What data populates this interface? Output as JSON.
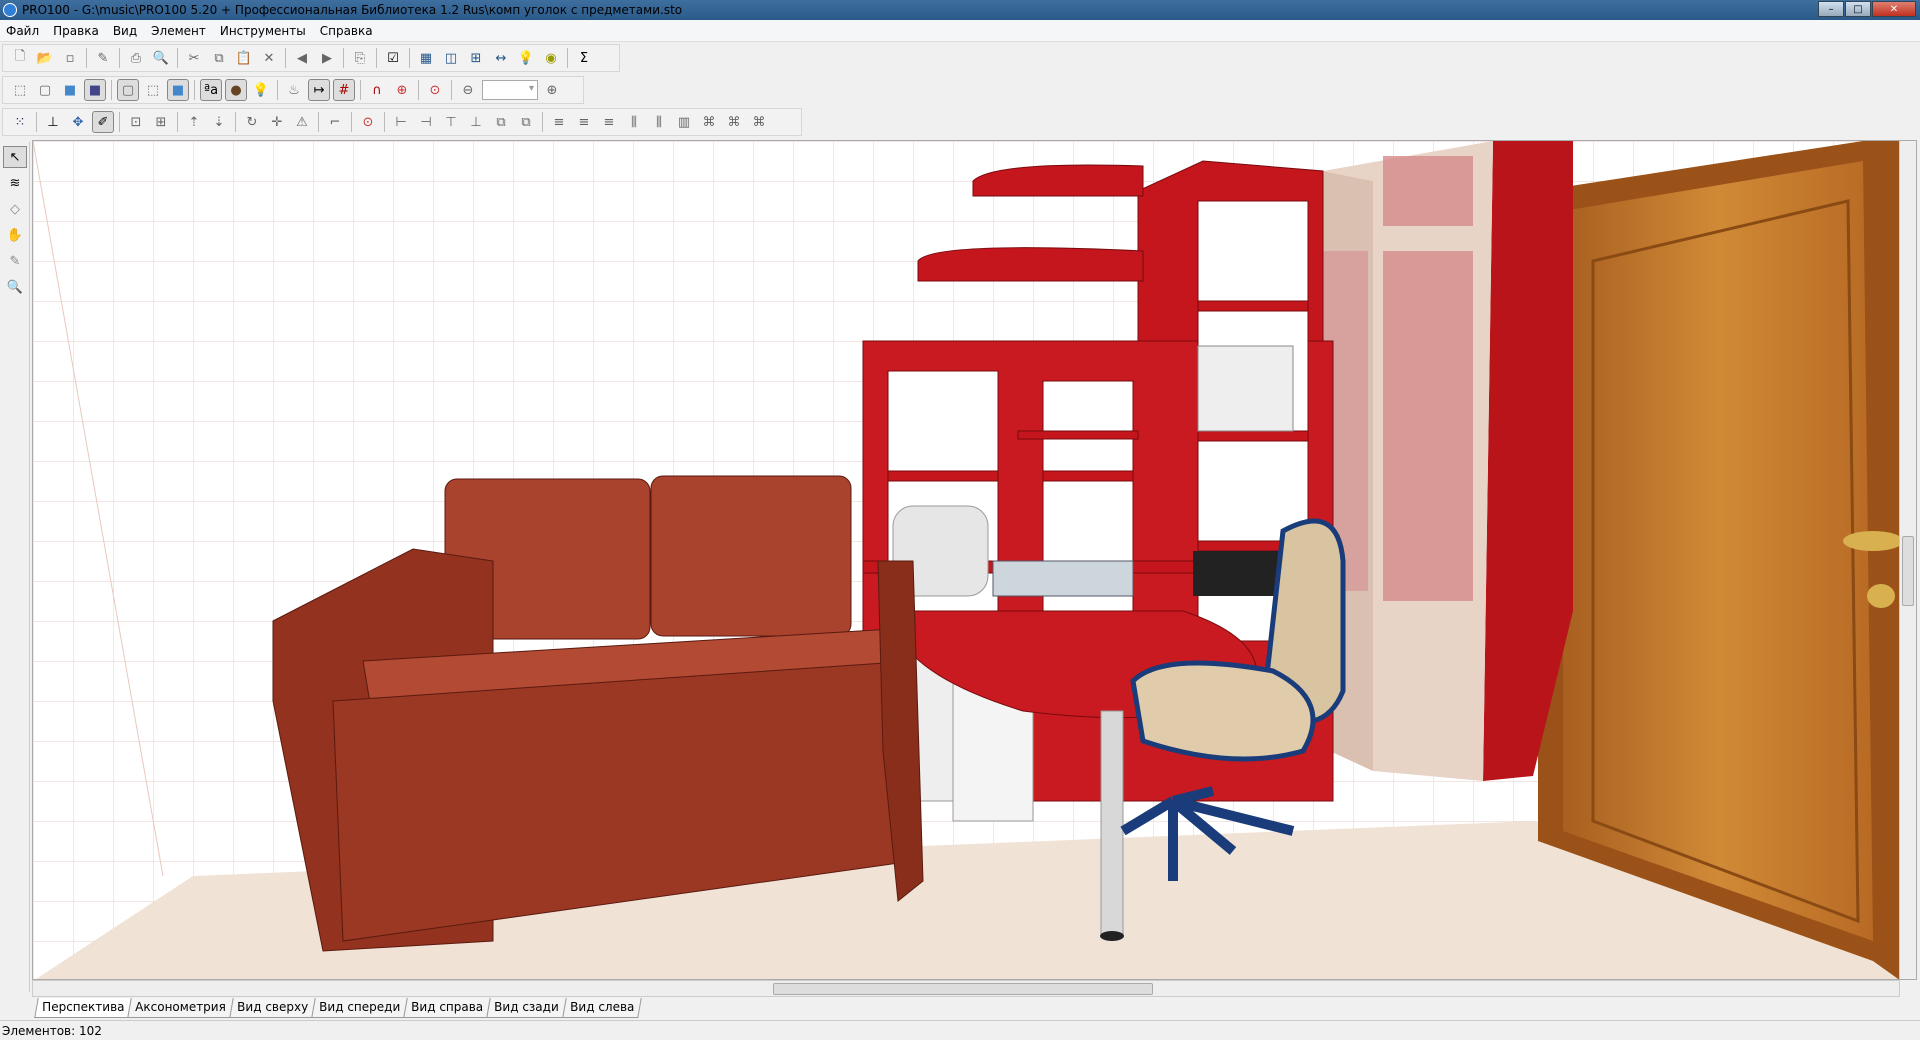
{
  "window": {
    "title": "PRO100 - G:\\music\\PRO100 5.20 + Профессиональная Библиотека 1.2 Rus\\комп уголок с предметами.sto"
  },
  "menu": [
    "Файл",
    "Правка",
    "Вид",
    "Элемент",
    "Инструменты",
    "Справка"
  ],
  "toolbar1": [
    "new-icon",
    "open-icon",
    "save-icon",
    "properties-icon",
    "print-icon",
    "print-preview-icon",
    "cut-icon",
    "copy-icon",
    "paste-icon",
    "delete-icon",
    "undo-icon",
    "redo-icon",
    "export-icon",
    "checklist-icon",
    "table-icon",
    "zoom-window-icon",
    "tree-icon",
    "dimensions-window-icon",
    "light-window-icon",
    "camera-window-icon",
    "sum-icon"
  ],
  "toolbar2": [
    "wireframe-icon",
    "outline-icon",
    "solid-icon",
    "shaded-icon",
    "view-box-icon",
    "view-persp-icon",
    "view-solid-icon",
    "text-icon",
    "material-icon",
    "light-icon",
    "texture-icon",
    "ruler-icon",
    "grid-icon",
    "magnet-icon",
    "snap-icon",
    "target-icon",
    "zoom-out-icon",
    "zoom-in-icon"
  ],
  "toolbar3": [
    "select-all-icon",
    "insert-icon",
    "move-icon",
    "edit-icon",
    "group-icon",
    "ungroup-icon",
    "raise-icon",
    "lower-icon",
    "rotate-icon",
    "move-cross-icon",
    "mirror-icon",
    "corner-icon",
    "target-icon",
    "align-icons"
  ],
  "zoom": {
    "value": ""
  },
  "tabs": [
    "Перспектива",
    "Аксонометрия",
    "Вид сверху",
    "Вид спереди",
    "Вид справа",
    "Вид сзади",
    "Вид слева"
  ],
  "status": "Элементов: 102",
  "colors": {
    "furniture": "#c4161c",
    "sofa": "#a8402c",
    "door": "#c87a2a",
    "floor": "#f2e2d6"
  }
}
